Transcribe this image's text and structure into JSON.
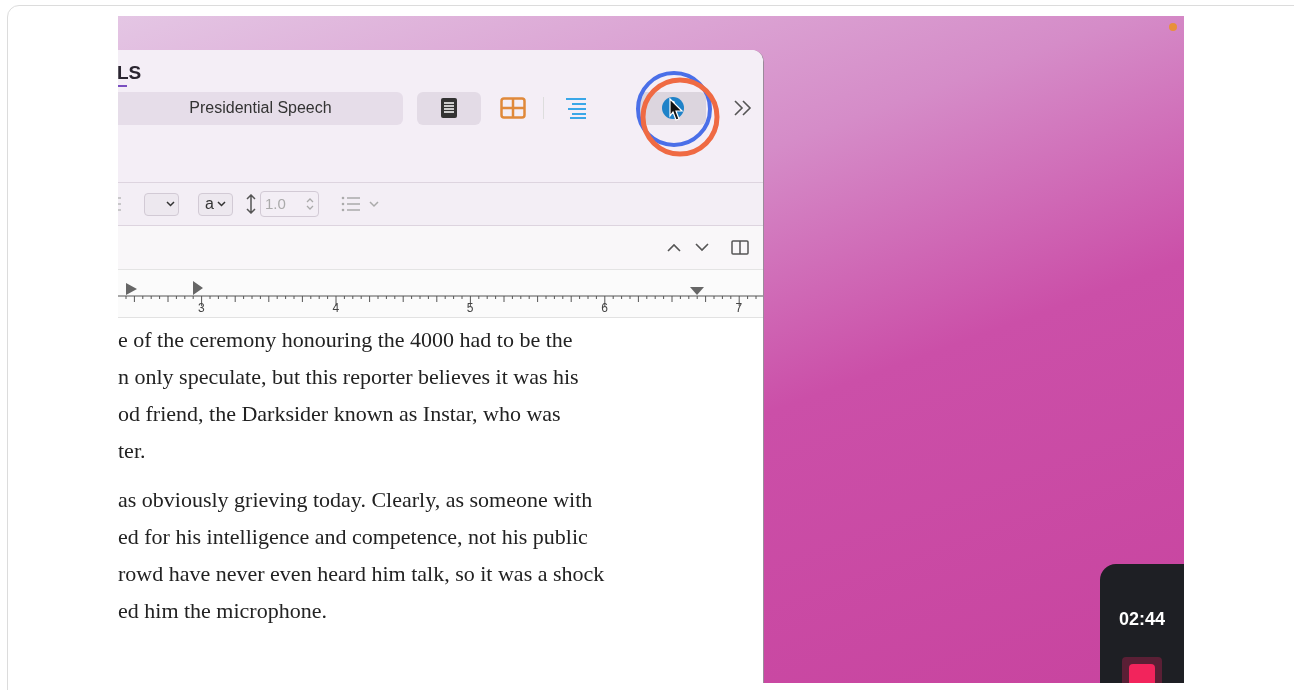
{
  "window": {
    "title": "LS"
  },
  "toolbar": {
    "document_title": "Presidential Speech",
    "view_selected": true
  },
  "format_bar": {
    "style_value": "a",
    "line_spacing": "1.0"
  },
  "ruler": {
    "labels": [
      "3",
      "4",
      "5",
      "6",
      "7"
    ]
  },
  "body": {
    "paragraphs": [
      {
        "lines": [
          "e of the ceremony honouring the 4000 had to be the",
          "n only speculate, but this reporter believes it was his",
          "od friend, the Darksider known as Instar, who was",
          "ter."
        ]
      },
      {
        "lines": [
          "as obviously grieving today. Clearly, as someone with",
          "ed for his intelligence and competence, not his public",
          "rowd have never even heard him talk, so it was a shock",
          "ed him the microphone."
        ]
      }
    ]
  },
  "recorder": {
    "timer": "02:44"
  }
}
